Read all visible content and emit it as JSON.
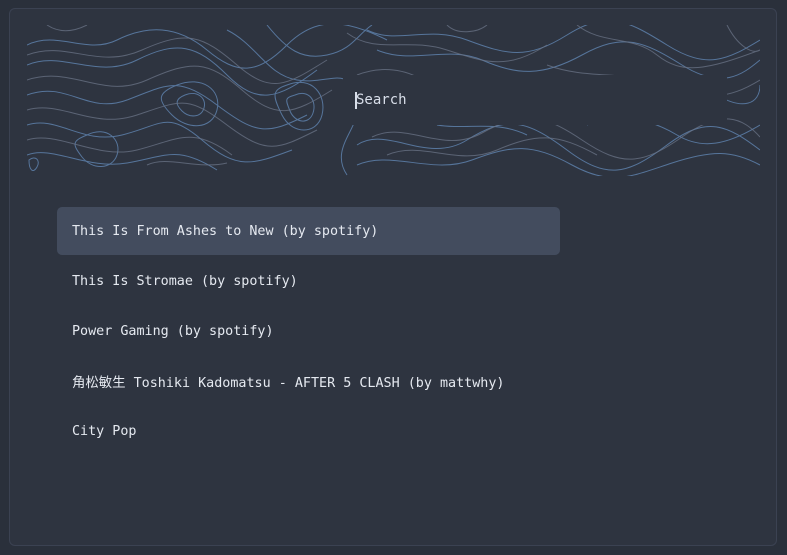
{
  "search": {
    "placeholder": "Search",
    "value": ""
  },
  "playlists": [
    {
      "label": "This Is From Ashes to New (by spotify)",
      "selected": true
    },
    {
      "label": "This Is Stromae (by spotify)",
      "selected": false
    },
    {
      "label": "Power Gaming (by spotify)",
      "selected": false
    },
    {
      "label": "角松敏生 Toshiki Kadomatsu - AFTER 5 CLASH (by mattwhy)",
      "selected": false
    },
    {
      "label": "City Pop",
      "selected": false
    }
  ],
  "colors": {
    "background": "#2e3440",
    "selected_row": "#434c5e",
    "text": "#e5e9f0",
    "contour_light": "#5e81ac",
    "contour_muted": "#6b7487"
  }
}
